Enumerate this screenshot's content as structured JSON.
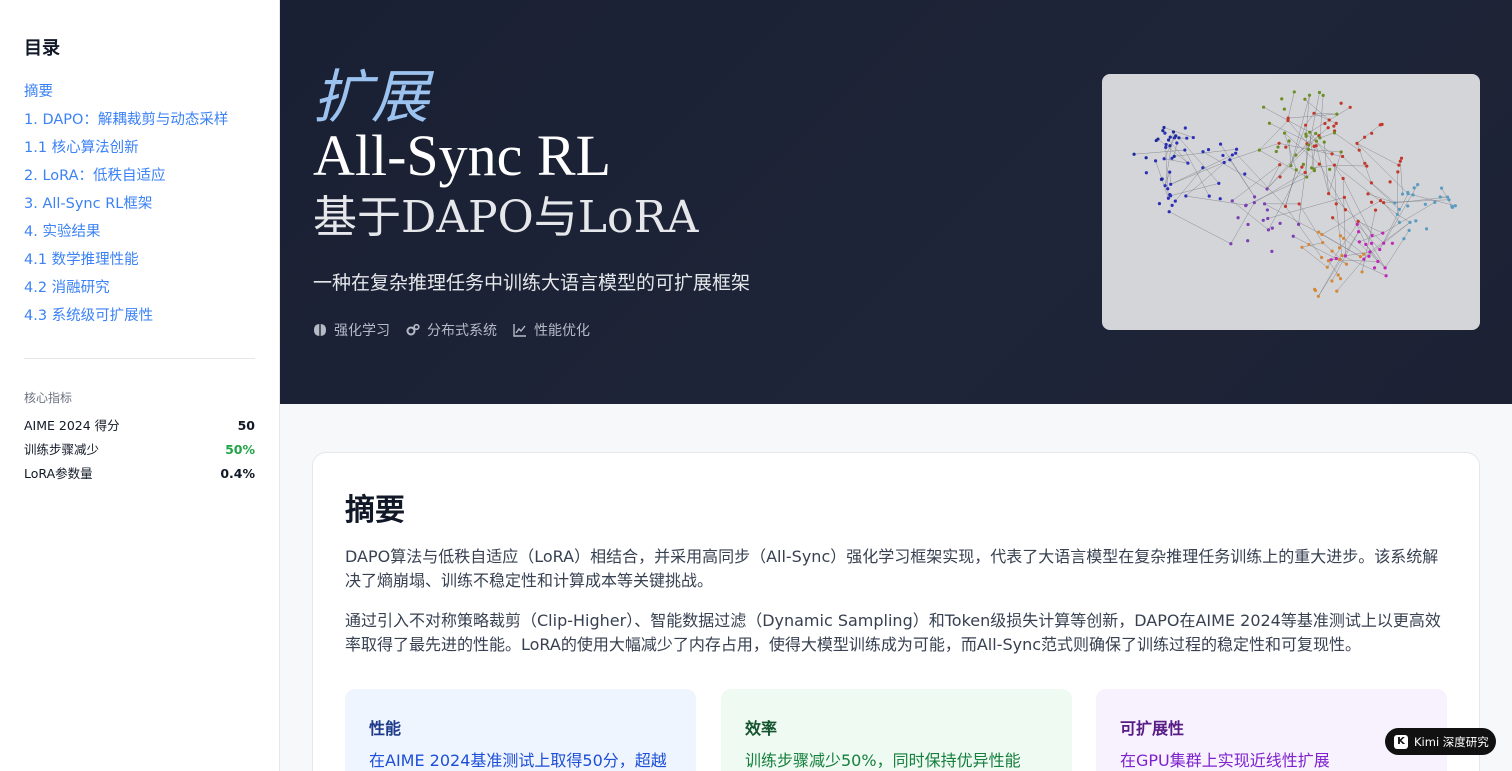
{
  "sidebar": {
    "title": "目录",
    "items": [
      {
        "label": "摘要"
      },
      {
        "label": "1. DAPO：解耦裁剪与动态采样"
      },
      {
        "label": "1.1 核心算法创新"
      },
      {
        "label": "2. LoRA：低秩自适应"
      },
      {
        "label": "3. All-Sync RL框架"
      },
      {
        "label": "4. 实验结果"
      },
      {
        "label": "4.1 数学推理性能"
      },
      {
        "label": "4.2 消融研究"
      },
      {
        "label": "4.3 系统级可扩展性"
      }
    ],
    "metrics_title": "核心指标",
    "metrics": [
      {
        "label": "AIME 2024 得分",
        "value": "50"
      },
      {
        "label": "训练步骤减少",
        "value": "50%"
      },
      {
        "label": "LoRA参数量",
        "value": "0.4%"
      }
    ]
  },
  "hero": {
    "italic": "扩展",
    "title": "All-Sync RL",
    "subtitle": "基于DAPO与LoRA",
    "description": "一种在复杂推理任务中训练大语言模型的可扩展框架",
    "tags": [
      {
        "label": "强化学习",
        "icon": "brain-icon"
      },
      {
        "label": "分布式系统",
        "icon": "gears-icon"
      },
      {
        "label": "性能优化",
        "icon": "chart-line-icon"
      }
    ]
  },
  "abstract": {
    "title": "摘要",
    "p1": "DAPO算法与低秩自适应（LoRA）相结合，并采用高同步（All-Sync）强化学习框架实现，代表了大语言模型在复杂推理任务训练上的重大进步。该系统解决了熵崩塌、训练不稳定性和计算成本等关键挑战。",
    "p2": "通过引入不对称策略裁剪（Clip-Higher）、智能数据过滤（Dynamic Sampling）和Token级损失计算等创新，DAPO在AIME 2024等基准测试上以更高效率取得了最先进的性能。LoRA的使用大幅减少了内存占用，使得大模型训练成为可能，而All-Sync范式则确保了训练过程的稳定性和可复现性。",
    "features": [
      {
        "title": "性能",
        "text": "在AIME 2024基准测试上取得50分，超越"
      },
      {
        "title": "效率",
        "text": "训练步骤减少50%，同时保持优异性能"
      },
      {
        "title": "可扩展性",
        "text": "在GPU集群上实现近线性扩展"
      }
    ]
  },
  "badge": {
    "logo": "K",
    "label": "Kimi 深度研究"
  },
  "colors": {
    "accent": "#3b82f6",
    "hero_bg": "#1c2234",
    "green": "#22a447"
  }
}
